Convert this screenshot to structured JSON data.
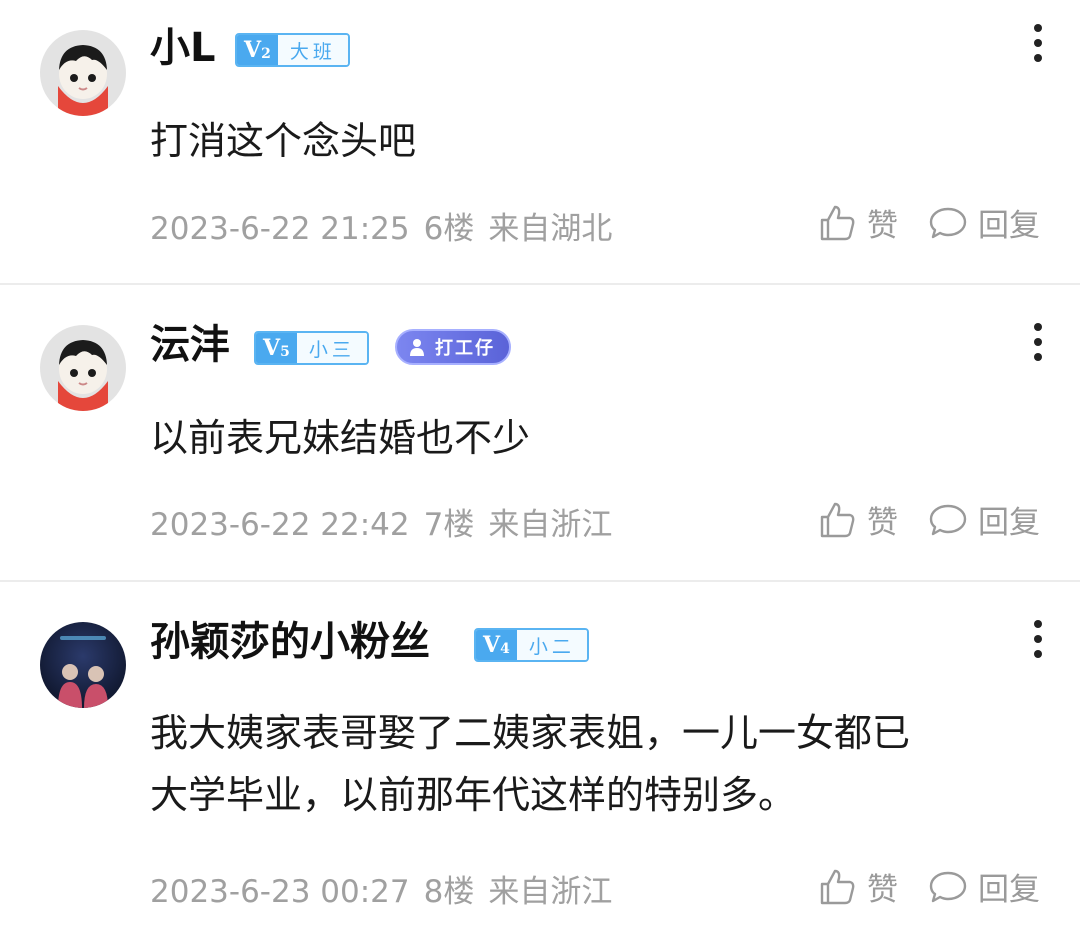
{
  "comments": [
    {
      "username": "小L",
      "level": "V",
      "level_num": "2",
      "level_title": "大班",
      "text": "打消这个念头吧",
      "time": "2023-6-22 21:25",
      "floor": "6楼",
      "location": "来自湖北",
      "like_label": "赞",
      "reply_label": "回复"
    },
    {
      "username": "沄沣",
      "level": "V",
      "level_num": "5",
      "level_title": "小三",
      "badge": "打工仔",
      "text": "以前表兄妹结婚也不少",
      "time": "2023-6-22 22:42",
      "floor": "7楼",
      "location": "来自浙江",
      "like_label": "赞",
      "reply_label": "回复"
    },
    {
      "username": "孙颖莎的小粉丝",
      "level": "V",
      "level_num": "4",
      "level_title": "小二",
      "text_line1": "我大姨家表哥娶了二姨家表姐，一儿一女都已",
      "text_line2": "大学毕业，以前那年代这样的特别多。",
      "time": "2023-6-23 00:27",
      "floor": "8楼",
      "location": "来自浙江",
      "like_label": "赞",
      "reply_label": "回复"
    }
  ],
  "colors": {
    "level_badge": "#4aa9ef",
    "work_badge": "#6a73e3",
    "meta_text": "#a0a0a0"
  }
}
